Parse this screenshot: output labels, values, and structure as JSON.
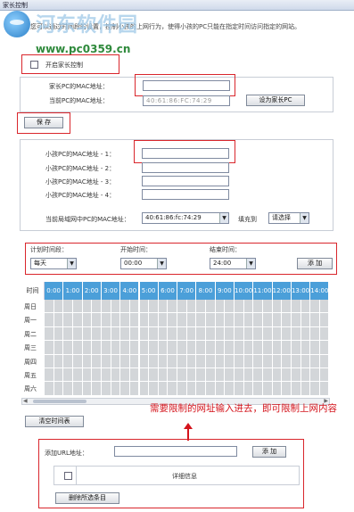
{
  "window": {
    "title": "家长控制"
  },
  "watermark": {
    "site_name": "河东软件园",
    "url": "www.pc0359.cn"
  },
  "intro_text": "本功能，您可以通过时间段的设置，控制小孩的上网行为，使得小孩的PC只能在指定时间访问指定的网站。",
  "parental_control": {
    "enable_label": "开启家长控制",
    "enabled": false
  },
  "parent_pc": {
    "mac_label": "家长PC的MAC地址：",
    "mac_value": "",
    "current_mac_label": "当前PC的MAC地址：",
    "current_mac_value": "40:61:86:FC:74:29",
    "set_as_parent_button": "设为家长PC",
    "save_button": "保 存"
  },
  "child_macs": {
    "items": [
      {
        "label": "小孩PC的MAC地址 - 1：",
        "value": ""
      },
      {
        "label": "小孩PC的MAC地址 - 2：",
        "value": ""
      },
      {
        "label": "小孩PC的MAC地址 - 3：",
        "value": ""
      },
      {
        "label": "小孩PC的MAC地址 - 4：",
        "value": ""
      }
    ],
    "lan_mac_label": "当前局域网中PC的MAC地址：",
    "lan_mac_value": "40:61:86:fc:74:29",
    "fill_to_label": "填充到",
    "fill_select": "请选择"
  },
  "schedule": {
    "plan_label": "计划时间段：",
    "plan_value": "每天",
    "start_label": "开始时间：",
    "start_value": "00:00",
    "end_label": "结束时间：",
    "end_value": "24:00",
    "add_button": "添 加",
    "time_header": "时间",
    "hours": [
      "0:00",
      "1:00",
      "2:00",
      "3:00",
      "4:00",
      "5:00",
      "6:00",
      "7:00",
      "8:00",
      "9:00",
      "10:00",
      "11:00",
      "12:00",
      "13:00",
      "14:00"
    ],
    "days": [
      "周日",
      "周一",
      "周二",
      "周三",
      "周四",
      "周五",
      "周六"
    ],
    "clear_button": "清空时间表"
  },
  "annotation": {
    "text": "需要限制的网址输入进去，即可限制上网内容",
    "color": "#d4141c"
  },
  "url_filter": {
    "add_url_label": "添加URL地址：",
    "url_value": "",
    "add_button": "添 加",
    "details_header": "详细信息",
    "delete_button": "删除所选条目"
  }
}
